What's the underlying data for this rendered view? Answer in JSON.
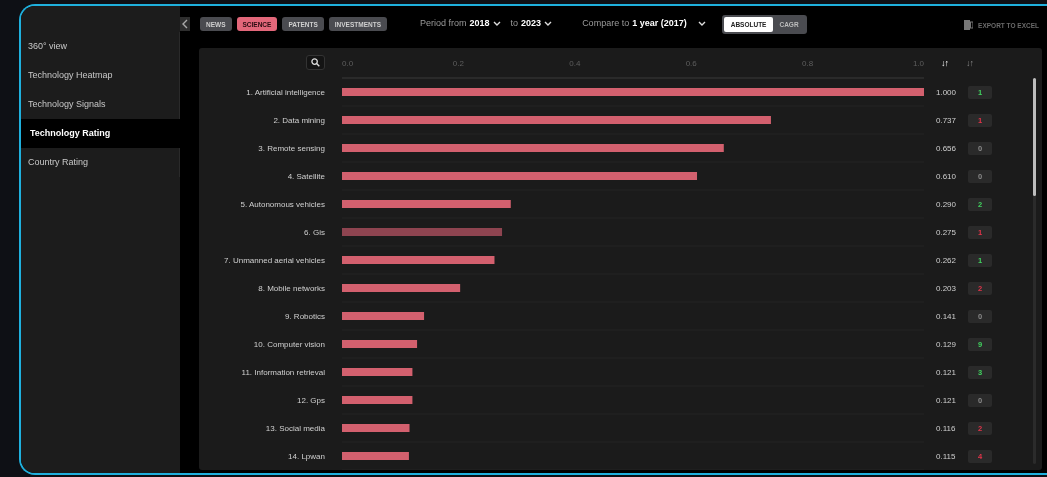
{
  "sidebar": {
    "items": [
      {
        "label": "360° view",
        "selected": false
      },
      {
        "label": "Technology Heatmap",
        "selected": false
      },
      {
        "label": "Technology Signals",
        "selected": false
      },
      {
        "label": "Technology Rating",
        "selected": true
      },
      {
        "label": "Country Rating",
        "selected": false
      }
    ]
  },
  "source_tabs": [
    {
      "label": "NEWS",
      "selected": false
    },
    {
      "label": "SCIENCE",
      "selected": true
    },
    {
      "label": "PATENTS",
      "selected": false
    },
    {
      "label": "INVESTMENTS",
      "selected": false
    }
  ],
  "period": {
    "from_label": "Period from",
    "from_value": "2018",
    "to_label": "to",
    "to_value": "2023"
  },
  "compare": {
    "label": "Compare to",
    "value": "1 year (2017)"
  },
  "mode_toggle": [
    {
      "label": "ABSOLUTE",
      "selected": true
    },
    {
      "label": "CAGR",
      "selected": false
    }
  ],
  "export": {
    "label": "EXPORT TO EXCEL"
  },
  "sort_columns": [
    {
      "label": "↓↑",
      "selected": true
    },
    {
      "label": "↓↑",
      "selected": false
    }
  ],
  "chart_data": {
    "type": "bar",
    "orientation": "horizontal",
    "xlim": [
      0,
      1
    ],
    "xticks": [
      {
        "value": 0,
        "label": "0.0"
      },
      {
        "value": 0.2,
        "label": "0.2"
      },
      {
        "value": 0.4,
        "label": "0.4"
      },
      {
        "value": 0.6,
        "label": "0.6"
      },
      {
        "value": 0.8,
        "label": "0.8"
      },
      {
        "value": 1,
        "label": "1.0"
      }
    ],
    "categories": [
      "1. Artificial intelligence",
      "2. Data mining",
      "3. Remote sensing",
      "4. Satellite",
      "5. Autonomous vehicles",
      "6. Gis",
      "7. Unmanned aerial vehicles",
      "8. Mobile networks",
      "9. Robotics",
      "10. Computer vision",
      "11. Information retrieval",
      "12. Gps",
      "13. Social media",
      "14. Lpwan"
    ],
    "values": [
      1.0,
      0.737,
      0.656,
      0.61,
      0.29,
      0.275,
      0.262,
      0.203,
      0.141,
      0.129,
      0.121,
      0.121,
      0.116,
      0.115
    ]
  },
  "rows": [
    {
      "reading": "1.000",
      "change": "1",
      "kind": "up",
      "highlighted": false
    },
    {
      "reading": "0.737",
      "change": "1",
      "kind": "down",
      "highlighted": false
    },
    {
      "reading": "0.656",
      "change": "0",
      "kind": "same",
      "highlighted": false
    },
    {
      "reading": "0.610",
      "change": "0",
      "kind": "same",
      "highlighted": false
    },
    {
      "reading": "0.290",
      "change": "2",
      "kind": "up",
      "highlighted": false
    },
    {
      "reading": "0.275",
      "change": "1",
      "kind": "down",
      "highlighted": true
    },
    {
      "reading": "0.262",
      "change": "1",
      "kind": "up",
      "highlighted": false
    },
    {
      "reading": "0.203",
      "change": "2",
      "kind": "down",
      "highlighted": false
    },
    {
      "reading": "0.141",
      "change": "0",
      "kind": "same",
      "highlighted": false
    },
    {
      "reading": "0.129",
      "change": "9",
      "kind": "up",
      "highlighted": false
    },
    {
      "reading": "0.121",
      "change": "3",
      "kind": "up",
      "highlighted": false
    },
    {
      "reading": "0.121",
      "change": "0",
      "kind": "same",
      "highlighted": false
    },
    {
      "reading": "0.116",
      "change": "2",
      "kind": "down",
      "highlighted": false
    },
    {
      "reading": "0.115",
      "change": "4",
      "kind": "down",
      "highlighted": false
    }
  ]
}
